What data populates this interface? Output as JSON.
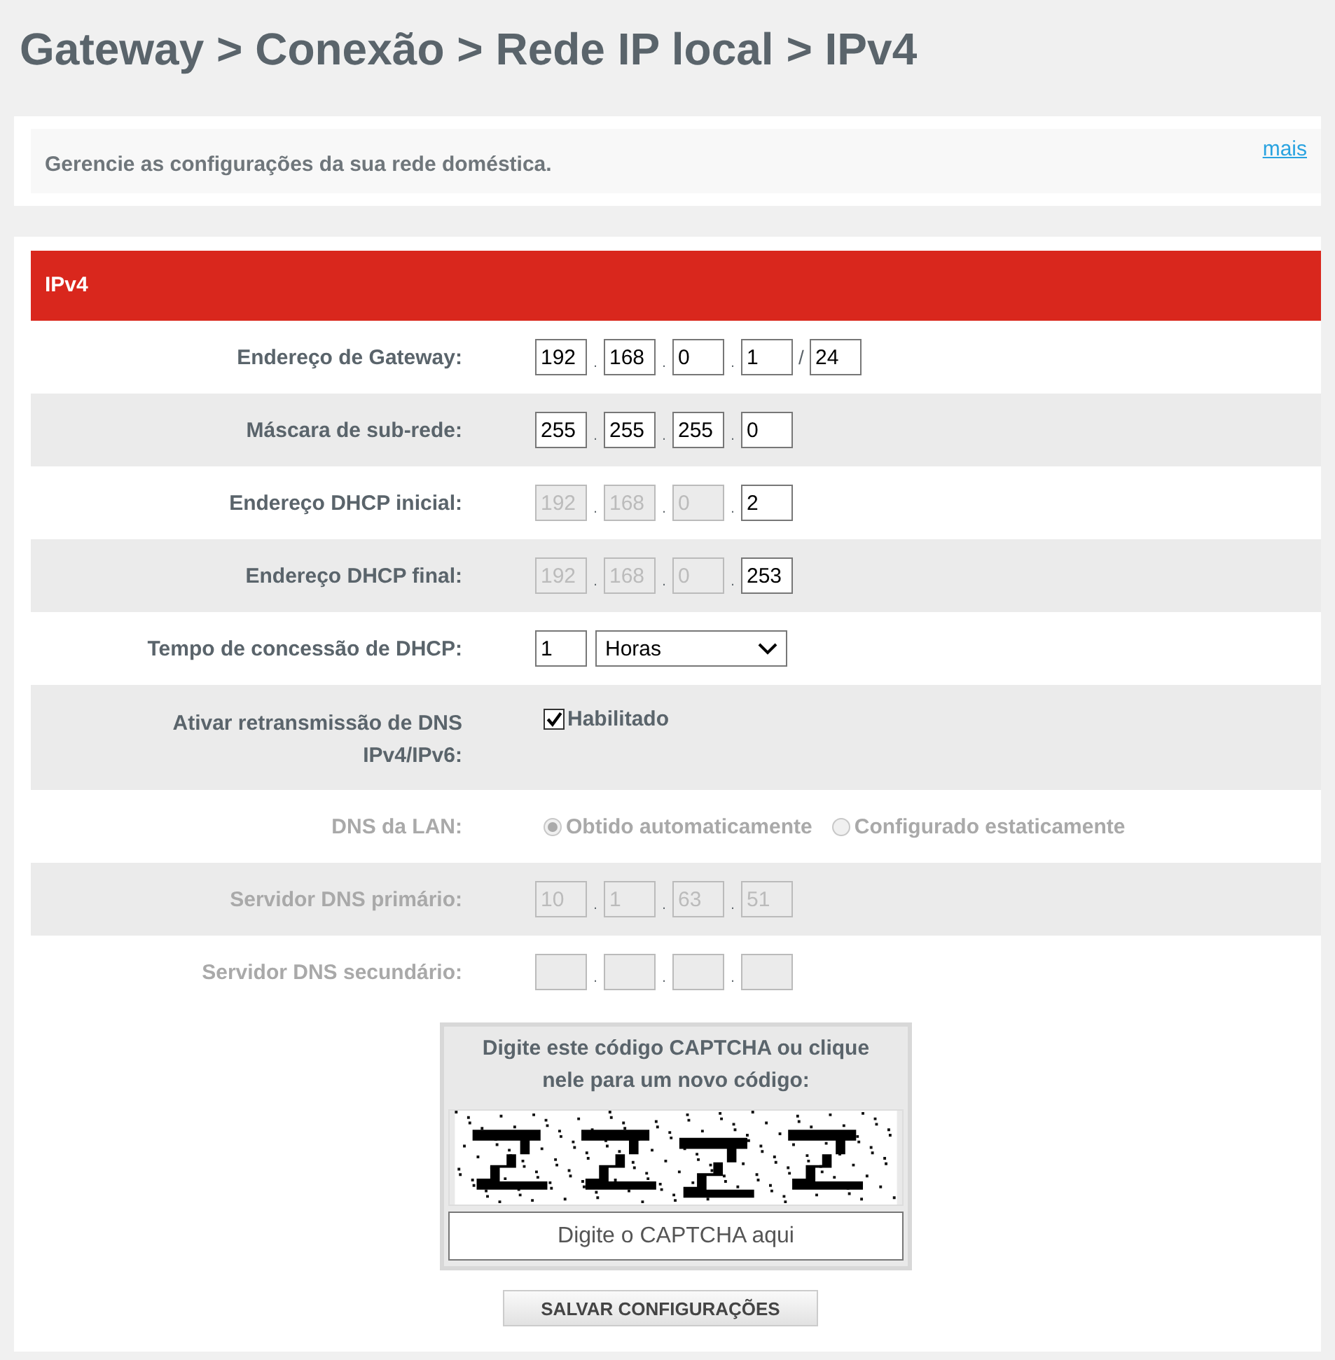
{
  "title": "Gateway > Conexão > Rede IP local > IPv4",
  "intro": {
    "text": "Gerencie as configurações da sua rede doméstica.",
    "link": "mais"
  },
  "section": {
    "title": "IPv4"
  },
  "rows": [
    {
      "kind": "ip",
      "label": "Endereço de Gateway:",
      "disabled": false,
      "separator": ".",
      "octets": [
        {
          "value": "192",
          "disabled": false
        },
        {
          "value": "168",
          "disabled": false
        },
        {
          "value": "0",
          "disabled": false
        },
        {
          "value": "1",
          "disabled": false
        }
      ],
      "prefix_separator": "/",
      "prefix": "24"
    },
    {
      "kind": "ip",
      "label": "Máscara de sub-rede:",
      "disabled": false,
      "separator": ".",
      "octets": [
        {
          "value": "255",
          "disabled": false
        },
        {
          "value": "255",
          "disabled": false
        },
        {
          "value": "255",
          "disabled": false
        },
        {
          "value": "0",
          "disabled": false
        }
      ]
    },
    {
      "kind": "ip",
      "label": "Endereço DHCP inicial:",
      "disabled": false,
      "separator": ".",
      "octets": [
        {
          "value": "192",
          "disabled": true
        },
        {
          "value": "168",
          "disabled": true
        },
        {
          "value": "0",
          "disabled": true
        },
        {
          "value": "2",
          "disabled": false
        }
      ]
    },
    {
      "kind": "ip",
      "label": "Endereço DHCP final:",
      "disabled": false,
      "separator": ".",
      "octets": [
        {
          "value": "192",
          "disabled": true
        },
        {
          "value": "168",
          "disabled": true
        },
        {
          "value": "0",
          "disabled": true
        },
        {
          "value": "253",
          "disabled": false
        }
      ]
    },
    {
      "kind": "lease",
      "label": "Tempo de concessão de DHCP:",
      "disabled": false,
      "value": "1",
      "unit": "Horas"
    },
    {
      "kind": "checkbox",
      "label": "Ativar retransmissão de DNS IPv4/IPv6:",
      "disabled": false,
      "option": "Habilitado",
      "checked": true
    },
    {
      "kind": "radio",
      "label": "DNS da LAN:",
      "disabled": true,
      "options": [
        {
          "label": "Obtido automaticamente",
          "selected": true
        },
        {
          "label": "Configurado estaticamente",
          "selected": false
        }
      ]
    },
    {
      "kind": "ip",
      "label": "Servidor DNS primário:",
      "disabled": true,
      "separator": ".",
      "octets": [
        {
          "value": "10",
          "disabled": true
        },
        {
          "value": "1",
          "disabled": true
        },
        {
          "value": "63",
          "disabled": true
        },
        {
          "value": "51",
          "disabled": true
        }
      ]
    },
    {
      "kind": "ip",
      "label": "Servidor DNS secundário:",
      "disabled": true,
      "separator": ".",
      "octets": [
        {
          "disabled": true
        },
        {
          "disabled": true
        },
        {
          "disabled": true
        },
        {
          "disabled": true
        }
      ]
    }
  ],
  "captcha": {
    "prompt": "Digite este código CAPTCHA ou clique nele para um novo código:",
    "placeholder": "Digite o CAPTCHA aqui"
  },
  "save_button": "SALVAR CONFIGURAÇÕES"
}
